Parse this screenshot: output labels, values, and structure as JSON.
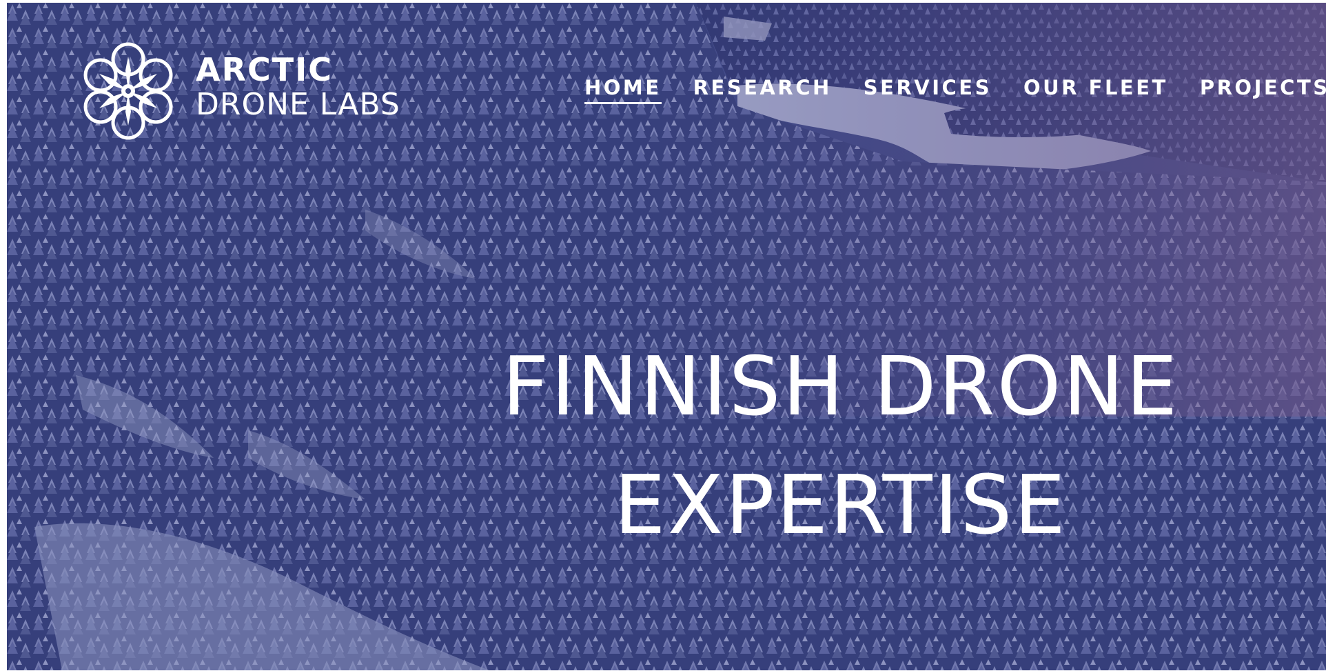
{
  "brand": {
    "line1": "ARCTIC",
    "line2": "DRONE LABS"
  },
  "nav": {
    "items": [
      {
        "label": "HOME",
        "active": true
      },
      {
        "label": "RESEARCH",
        "active": false
      },
      {
        "label": "SERVICES",
        "active": false
      },
      {
        "label": "OUR FLEET",
        "active": false
      },
      {
        "label": "PROJECTS",
        "active": false
      }
    ]
  },
  "hero": {
    "headline_line1": "FINNISH DRONE",
    "headline_line2": "EXPERTISE",
    "background": "aerial-snowy-forest-image"
  },
  "colors": {
    "text": "#ffffff",
    "overlay": "#3c4680",
    "snow": "#c9cde8"
  }
}
